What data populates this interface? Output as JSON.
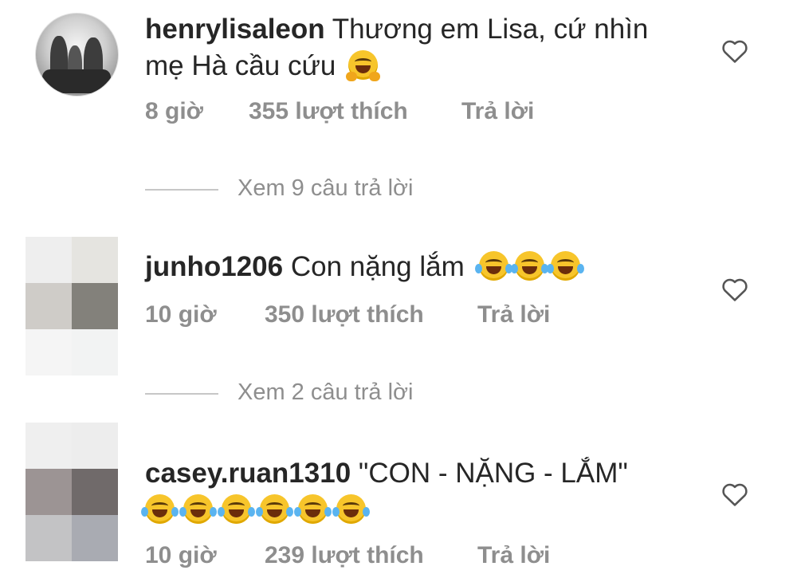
{
  "comments": [
    {
      "username": "henrylisaleon",
      "text_line1": "Thương em Lisa, cứ nhìn",
      "text_line2": "mẹ Hà cầu cứu",
      "time": "8 giờ",
      "likes": "355 lượt thích",
      "reply": "Trả lời",
      "view_replies": "Xem 9 câu trả lời",
      "emoji": "hugging-face"
    },
    {
      "username": "junho1206",
      "text_line1": "Con nặng lắm",
      "time": "10 giờ",
      "likes": "350 lượt thích",
      "reply": "Trả lời",
      "view_replies": "Xem 2 câu trả lời",
      "emoji": "tears-of-joy",
      "emoji_count": 3
    },
    {
      "username": "casey.ruan1310",
      "text_line1": "\"CON - NẶNG - LẮM\"",
      "time": "10 giờ",
      "likes": "239 lượt thích",
      "reply": "Trả lời",
      "emoji": "tears-of-joy",
      "emoji_count": 6
    }
  ],
  "icons": {
    "like": "heart-outline-icon"
  },
  "colors": {
    "meta_text": "#8e8e8e",
    "primary_text": "#262626",
    "divider": "#c7c7c7"
  }
}
